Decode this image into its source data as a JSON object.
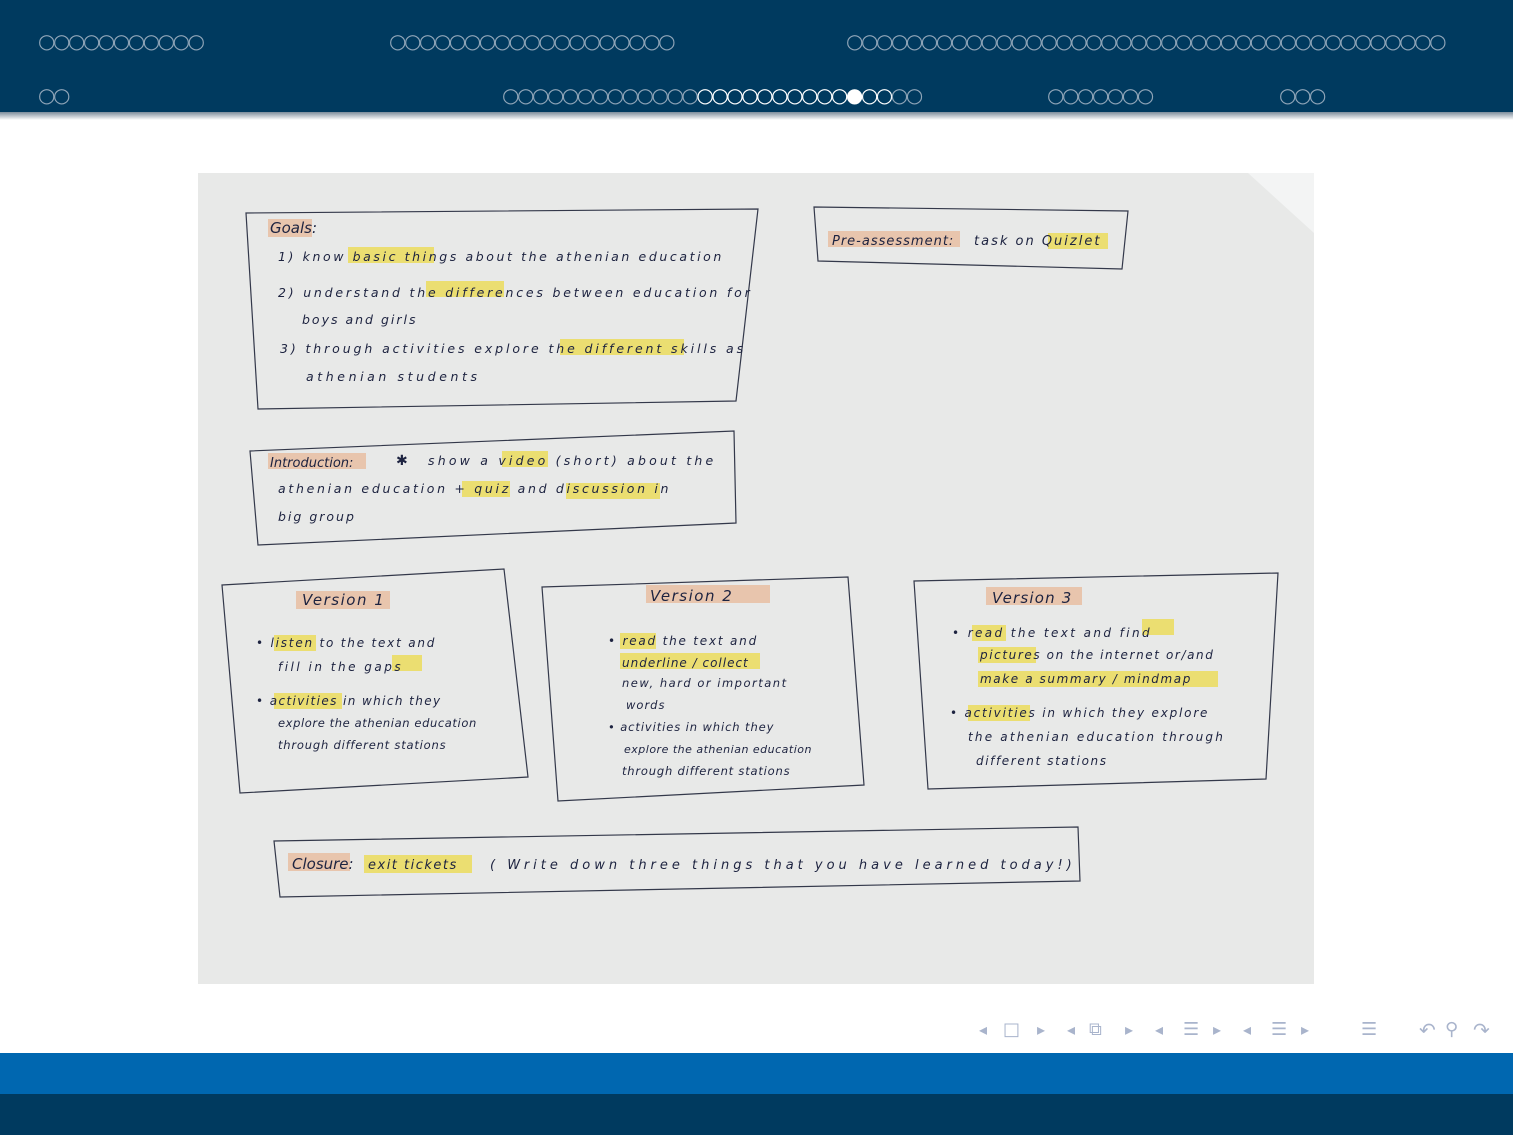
{
  "nav_dots": {
    "row1": [
      {
        "pre": "○○○○○○○○○○○",
        "cur": "",
        "post": ""
      },
      {
        "pre": "○○○○○○○○○○○○○○○○○○○",
        "cur": "",
        "post": ""
      },
      {
        "pre": "○○○○○○○○○○○○○○○○○○○○○○○○○○○○○○○○○○○○○○○○",
        "cur": "",
        "post": ""
      }
    ],
    "row2": [
      {
        "pre": "○○",
        "cur": "",
        "post": ""
      },
      {
        "pre": "○○○○○○○○○○○○○",
        "cur": "○○○○○○○○○○●○○",
        "post": "○○"
      },
      {
        "pre": "○○○○○○○",
        "cur": "",
        "post": ""
      },
      {
        "pre": "○○○",
        "cur": "",
        "post": ""
      }
    ]
  },
  "plan": {
    "goals": {
      "heading": "Goals:",
      "lines": [
        "1) know basic things about the athenian education",
        "2) understand the differences between education for",
        "boys and girls",
        "3) through activities explore the different skills as",
        "athenian students"
      ]
    },
    "pre_assessment": {
      "heading": "Pre-assessment:",
      "text": "task on Quizlet"
    },
    "introduction": {
      "heading": "Introduction:",
      "lines": [
        "show a video (short) about the",
        "athenian education + quiz and discussion in",
        "big group"
      ]
    },
    "version1": {
      "title": "Version 1",
      "bullets": [
        [
          "• listen to the text and",
          "fill in the gaps"
        ],
        [
          "• activities in which they",
          "explore the athenian education",
          "through different stations"
        ]
      ]
    },
    "version2": {
      "title": "Version 2",
      "bullets": [
        [
          "• read the text and",
          "underline / collect",
          "new, hard or important",
          "words"
        ],
        [
          "• activities in which they",
          "explore the athenian education",
          "through different stations"
        ]
      ]
    },
    "version3": {
      "title": "Version 3",
      "bullets": [
        [
          "• read the text and find",
          "pictures on the internet or/and",
          "make a summary / mindmap"
        ],
        [
          "• activities in which they explore",
          "the athenian education through",
          "different stations"
        ]
      ]
    },
    "closure": {
      "heading": "Closure:",
      "highlight": "exit tickets",
      "text": "( Write down three things that you have learned today!)"
    }
  },
  "nav_controls": {
    "prev_frame": "◂",
    "frame_icon": "□",
    "next_frame": "▸",
    "prev_subsection": "◂",
    "subsection_icon": "⧉",
    "next_subsection": "▸",
    "prev_section": "◂",
    "section_icon": "☰",
    "next_section": "▸",
    "prev_part": "◂",
    "part_icon": "☰",
    "next_part": "▸",
    "toc_icon": "☰",
    "back_icon": "↶",
    "search_icon": "⚲",
    "forward_icon": "↷"
  },
  "colors": {
    "header_bg": "#003a5f",
    "footer_top": "#0067b0",
    "footer_bottom": "#003a5f",
    "highlight_yellow": "#ecd94a",
    "highlight_salmon": "#e8b89a"
  }
}
